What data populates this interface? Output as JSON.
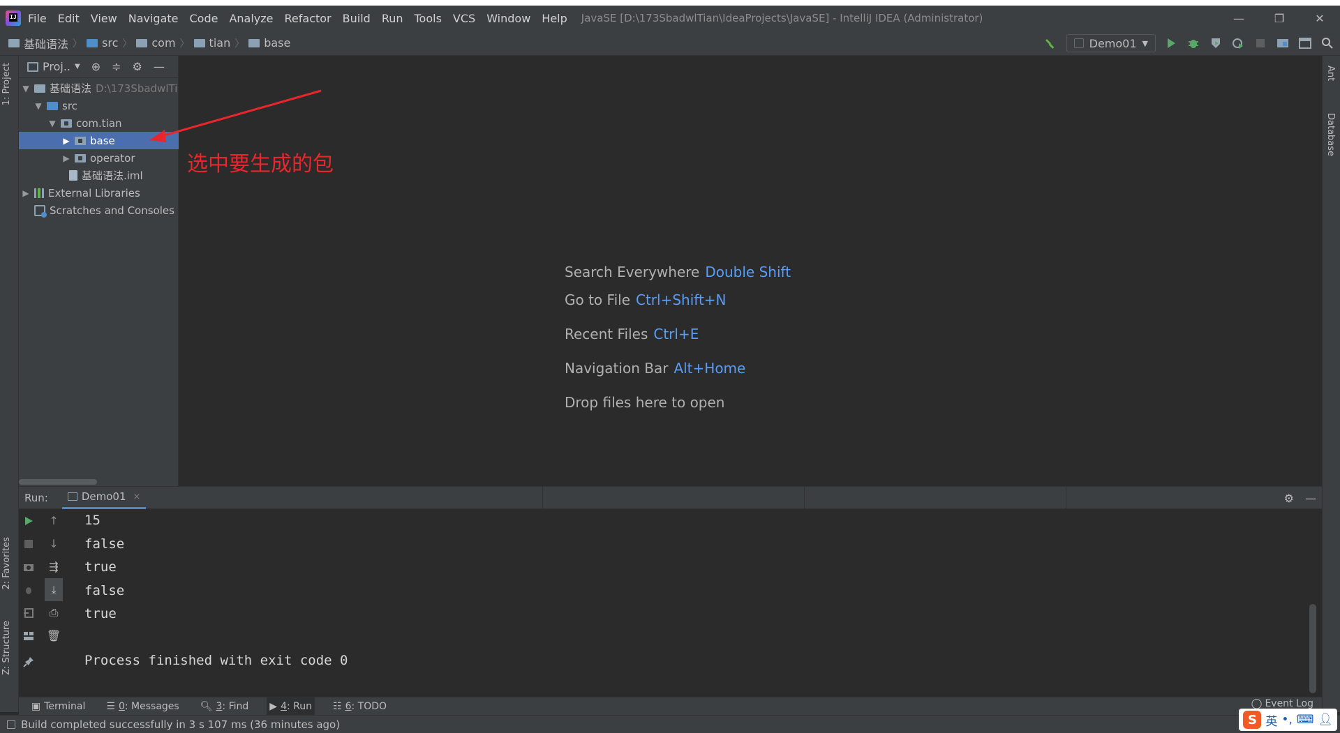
{
  "window": {
    "title": "JavaSE [D:\\173SbadwlTian\\IdeaProjects\\JavaSE] - IntelliJ IDEA (Administrator)",
    "logo_text": "IJ"
  },
  "menu": [
    "File",
    "Edit",
    "View",
    "Navigate",
    "Code",
    "Analyze",
    "Refactor",
    "Build",
    "Run",
    "Tools",
    "VCS",
    "Window",
    "Help"
  ],
  "window_controls": {
    "minimize": "—",
    "restore": "❐",
    "close": "✕"
  },
  "breadcrumb": [
    "基础语法",
    "src",
    "com",
    "tian",
    "base"
  ],
  "toolbar": {
    "run_config": "Demo01",
    "icons": [
      "build-hammer-icon",
      "run-icon",
      "debug-icon",
      "coverage-icon",
      "profile-icon",
      "stop-icon",
      "project-structure-icon",
      "terminal-layout-icon",
      "search-icon"
    ]
  },
  "left_stripe": {
    "project_tab": "1: Project",
    "favorites_tab": "2: Favorites",
    "structure_tab": "Z: Structure"
  },
  "right_stripe": {
    "ant_tab": "Ant",
    "database_tab": "Database"
  },
  "project_panel": {
    "title": "Proj..",
    "tree": [
      {
        "label": "基础语法",
        "extra": "D:\\173SbadwlTi",
        "level": 0,
        "expanded": true,
        "icon": "module-folder-icon"
      },
      {
        "label": "src",
        "extra": "",
        "level": 1,
        "expanded": true,
        "icon": "source-folder-icon"
      },
      {
        "label": "com.tian",
        "extra": "",
        "level": 2,
        "expanded": true,
        "icon": "package-icon"
      },
      {
        "label": "base",
        "extra": "",
        "level": 3,
        "expanded": false,
        "icon": "package-icon",
        "selected": true
      },
      {
        "label": "operator",
        "extra": "",
        "level": 3,
        "expanded": false,
        "icon": "package-icon"
      },
      {
        "label": "基础语法.iml",
        "extra": "",
        "level": 2,
        "expanded": null,
        "icon": "iml-file-icon"
      },
      {
        "label": "External Libraries",
        "extra": "",
        "level": 0,
        "expanded": false,
        "icon": "library-icon"
      },
      {
        "label": "Scratches and Consoles",
        "extra": "",
        "level": 0,
        "expanded": null,
        "icon": "scratch-icon"
      }
    ]
  },
  "annotation": {
    "text": "选中要生成的包",
    "color": "#e8262c"
  },
  "editor_hints": [
    {
      "label": "Search Everywhere",
      "key": "Double Shift"
    },
    {
      "label": "Go to File",
      "key": "Ctrl+Shift+N"
    },
    {
      "label": "Recent Files",
      "key": "Ctrl+E"
    },
    {
      "label": "Navigation Bar",
      "key": "Alt+Home"
    },
    {
      "label": "Drop files here to open",
      "key": ""
    }
  ],
  "run_window": {
    "label": "Run:",
    "tab": "Demo01",
    "tab_close": "×",
    "console_lines": [
      "15",
      "false",
      "true",
      "false",
      "true",
      "",
      "Process finished with exit code 0"
    ]
  },
  "bottom_tools": [
    {
      "label": "Terminal",
      "num": "",
      "icon": "terminal-icon"
    },
    {
      "label": ": Messages",
      "num": "0",
      "icon": "messages-icon"
    },
    {
      "label": ": Find",
      "num": "3",
      "icon": "find-icon"
    },
    {
      "label": ": Run",
      "num": "4",
      "icon": "run-icon",
      "active": true
    },
    {
      "label": ": TODO",
      "num": "6",
      "icon": "todo-icon"
    }
  ],
  "event_log": "Event Log",
  "status": {
    "message": "Build completed successfully in 3 s 107 ms (36 minutes ago)"
  },
  "ime": {
    "logo": "S",
    "mode": "英",
    "punct": "•,"
  },
  "colors": {
    "accent": "#4b6eaf",
    "link": "#589df6",
    "annotation": "#e8262c",
    "run_green": "#59a869"
  }
}
